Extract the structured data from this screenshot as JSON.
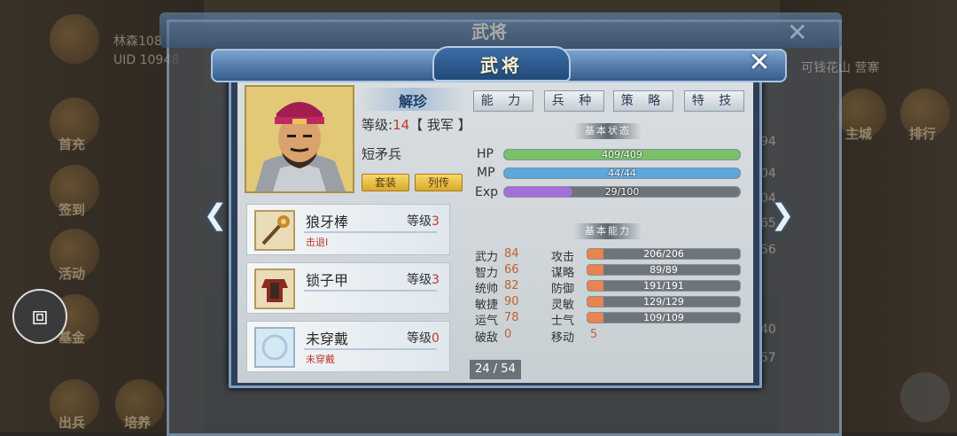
{
  "background": {
    "title": "武将",
    "user_name": "林森108",
    "uid": "UID 10948",
    "header_right": "可钱花山 营寨",
    "side_left": [
      "首充",
      "签到",
      "活动",
      "基金",
      "出兵",
      "培养"
    ],
    "side_right": [
      "主城",
      "排行"
    ],
    "list_numbers": [
      "94",
      "04",
      "04",
      "65",
      "56",
      "40",
      "57"
    ]
  },
  "panel": {
    "title": "武将",
    "close_icon": "close-icon"
  },
  "hero": {
    "name": "解珍",
    "level_prefix": "等级:",
    "level": "14",
    "faction": "【 我军 】",
    "troop_type": "短矛兵",
    "btn_outfit": "套装",
    "btn_bio": "列传"
  },
  "tabs": [
    "能 力",
    "兵 种",
    "策 略",
    "特 技"
  ],
  "equipment": [
    {
      "name": "狼牙棒",
      "level_label": "等级",
      "level": "3",
      "desc": "击退Ⅰ",
      "icon": "mace-icon"
    },
    {
      "name": "锁子甲",
      "level_label": "等级",
      "level": "3",
      "desc": "",
      "icon": "armor-icon"
    },
    {
      "name": "未穿戴",
      "level_label": "等级",
      "level": "0",
      "desc": "未穿戴",
      "icon": "empty-slot-icon"
    }
  ],
  "status": {
    "section_title": "基本状态",
    "bars": [
      {
        "label": "HP",
        "text": "409/409",
        "fraction": 1.0,
        "color": "#79c26a"
      },
      {
        "label": "MP",
        "text": "44/44",
        "fraction": 1.0,
        "color": "#5aa8de"
      },
      {
        "label": "Exp",
        "text": "29/100",
        "fraction": 0.29,
        "color": "#a46fd9"
      }
    ]
  },
  "abilities": {
    "section_title": "基本能力",
    "base": [
      {
        "label": "武力",
        "value": "84"
      },
      {
        "label": "智力",
        "value": "66"
      },
      {
        "label": "统帅",
        "value": "82"
      },
      {
        "label": "敏捷",
        "value": "90"
      },
      {
        "label": "运气",
        "value": "78"
      },
      {
        "label": "破敌",
        "value": "0"
      }
    ],
    "combat": [
      {
        "label": "攻击",
        "text": "206/206"
      },
      {
        "label": "谋略",
        "text": "89/89"
      },
      {
        "label": "防御",
        "text": "191/191"
      },
      {
        "label": "灵敏",
        "text": "129/129"
      },
      {
        "label": "士气",
        "text": "109/109"
      }
    ],
    "move_label": "移动",
    "move_value": "5"
  },
  "pager": {
    "current": "24",
    "total": "54",
    "text": "24 / 54"
  }
}
